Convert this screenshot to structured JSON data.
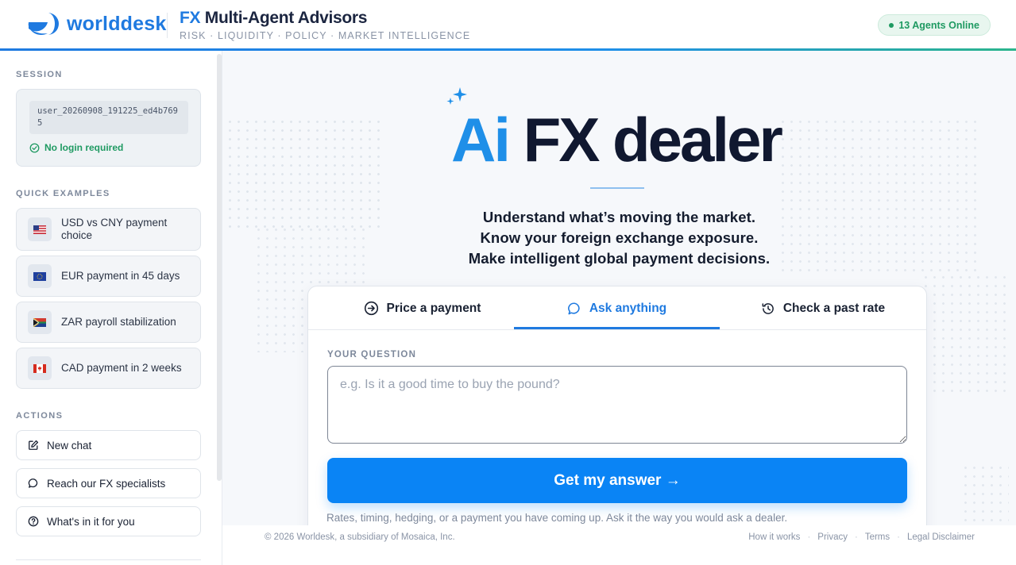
{
  "header": {
    "logo_text_a": "world",
    "logo_text_b": "desk",
    "title_fx": "FX",
    "title_rest": "Multi-Agent Advisors",
    "subtitle": "RISK · LIQUIDITY · POLICY · MARKET INTELLIGENCE",
    "agents_online": "13 Agents Online"
  },
  "sidebar": {
    "session_label": "SESSION",
    "session_id": "user_20260908_191225_ed4b7695",
    "no_login": "No login required",
    "quick_examples_label": "QUICK EXAMPLES",
    "examples": [
      {
        "label": "USD vs CNY payment choice",
        "flag": "us-flag-icon"
      },
      {
        "label": "EUR payment in 45 days",
        "flag": "eu-flag-icon"
      },
      {
        "label": "ZAR payroll stabilization",
        "flag": "za-flag-icon"
      },
      {
        "label": "CAD payment in 2 weeks",
        "flag": "ca-flag-icon"
      }
    ],
    "actions_label": "ACTIONS",
    "actions": [
      {
        "label": "New chat",
        "icon": "edit-icon"
      },
      {
        "label": "Reach our FX specialists",
        "icon": "chat-bubble-icon"
      },
      {
        "label": "What's in it for you",
        "icon": "help-circle-icon"
      }
    ]
  },
  "hero": {
    "title_ai": "Ai",
    "title_rest": "FX dealer",
    "lines": [
      "Understand what’s moving the market.",
      "Know your foreign exchange exposure.",
      "Make intelligent global payment decisions."
    ]
  },
  "panel": {
    "tabs": [
      {
        "label": "Price a payment",
        "icon": "arrow-circle-icon",
        "active": false
      },
      {
        "label": "Ask anything",
        "icon": "chat-bubble-icon",
        "active": true
      },
      {
        "label": "Check a past rate",
        "icon": "history-icon",
        "active": false
      }
    ],
    "question_label": "YOUR QUESTION",
    "question_placeholder": "e.g. Is it a good time to buy the pound?",
    "question_value": "",
    "submit_label": "Get my answer →",
    "hint": "Rates, timing, hedging, or a payment you have coming up. Ask it the way you would ask a dealer."
  },
  "footer": {
    "copyright": "© 2026 Worldesk, a subsidiary of Mosaica, Inc.",
    "links": [
      "How it works",
      "Privacy",
      "Terms",
      "Legal Disclaimer"
    ]
  },
  "colors": {
    "accent": "#1f7ae0",
    "button": "#0a84f5",
    "success": "#1f9a62",
    "ink": "#101830"
  }
}
